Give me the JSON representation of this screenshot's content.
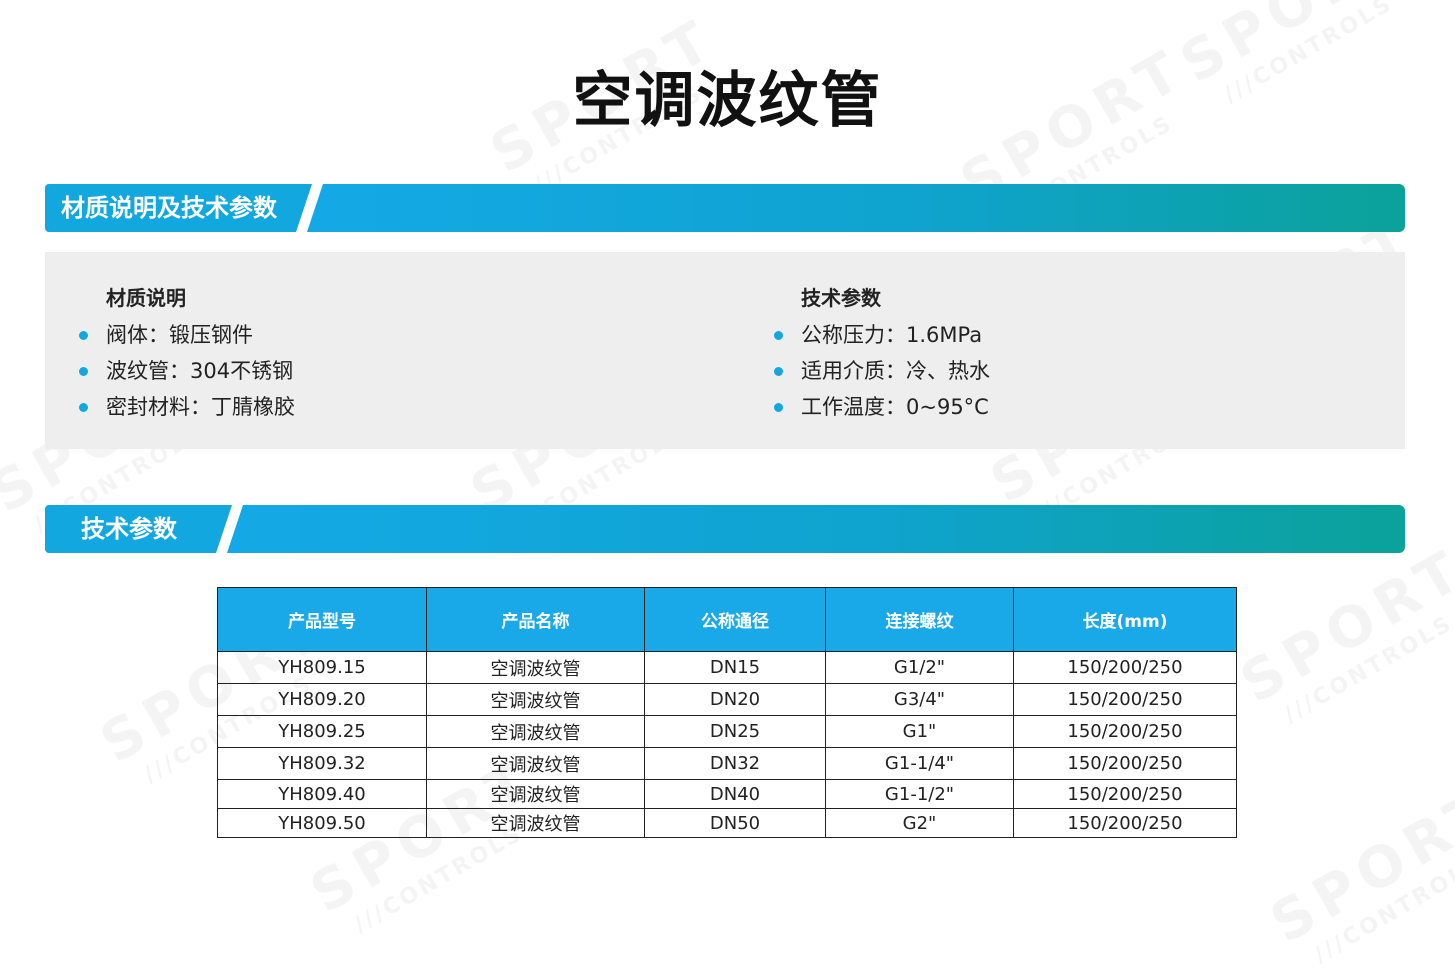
{
  "page_title": "空调波纹管",
  "watermark": {
    "main": "SPORT",
    "sub": "///CONTROLS"
  },
  "section1": {
    "heading": "材质说明及技术参数",
    "left": {
      "title": "材质说明",
      "items": [
        "阀体：锻压钢件",
        "波纹管：304不锈钢",
        "密封材料：丁腈橡胶"
      ]
    },
    "right": {
      "title": "技术参数",
      "items": [
        "公称压力：1.6MPa",
        "适用介质：冷、热水",
        "工作温度：0~95°C"
      ]
    }
  },
  "section2": {
    "heading": "技术参数"
  },
  "table": {
    "headers": [
      "产品型号",
      "产品名称",
      "公称通径",
      "连接螺纹",
      "长度(mm)"
    ],
    "rows": [
      [
        "YH809.15",
        "空调波纹管",
        "DN15",
        "G1/2\"",
        "150/200/250"
      ],
      [
        "YH809.20",
        "空调波纹管",
        "DN20",
        "G3/4\"",
        "150/200/250"
      ],
      [
        "YH809.25",
        "空调波纹管",
        "DN25",
        "G1\"",
        "150/200/250"
      ],
      [
        "YH809.32",
        "空调波纹管",
        "DN32",
        "G1-1/4\"",
        "150/200/250"
      ],
      [
        "YH809.40",
        "空调波纹管",
        "DN40",
        "G1-1/2\"",
        "150/200/250"
      ],
      [
        "YH809.50",
        "空调波纹管",
        "DN50",
        "G2\"",
        "150/200/250"
      ]
    ]
  },
  "colors": {
    "accent_blue": "#13a7df",
    "accent_teal": "#0ba29a",
    "table_header": "#1aa9e8",
    "panel_bg": "#eeeeee"
  }
}
